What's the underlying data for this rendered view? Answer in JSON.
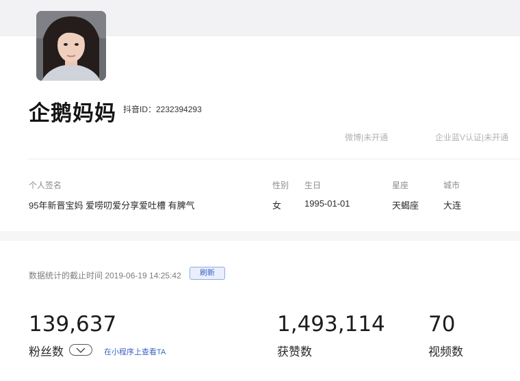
{
  "profile": {
    "nickname": "企鹅妈妈",
    "douyin_id": "抖音ID：2232394293",
    "weibo": "微博|未开通",
    "blue_v": "企业蓝V认证|未开通"
  },
  "info": {
    "signature_label": "个人签名",
    "signature_value": "95年新晋宝妈 爱唠叨爱分享爱吐槽 有脾气",
    "gender_label": "性别",
    "gender_value": "女",
    "birthday_label": "生日",
    "birthday_value": "1995-01-01",
    "zodiac_label": "星座",
    "zodiac_value": "天蝎座",
    "city_label": "城市",
    "city_value": "大连"
  },
  "stats": {
    "cutoff_text": "数据统计的截止时间 2019-06-19 14:25:42",
    "refresh_label": "刷新",
    "fans_value": "139,637",
    "fans_label": "粉丝数",
    "mini_program_link": "在小程序上查看TA",
    "likes_value": "1,493,114",
    "likes_label": "获赞数",
    "videos_value": "70",
    "videos_label": "视频数"
  },
  "icons": {
    "fans_toggle": "chevron-down-icon"
  },
  "colors": {
    "accent_blue": "#3a64c7",
    "muted_text": "#b3b3b3"
  }
}
